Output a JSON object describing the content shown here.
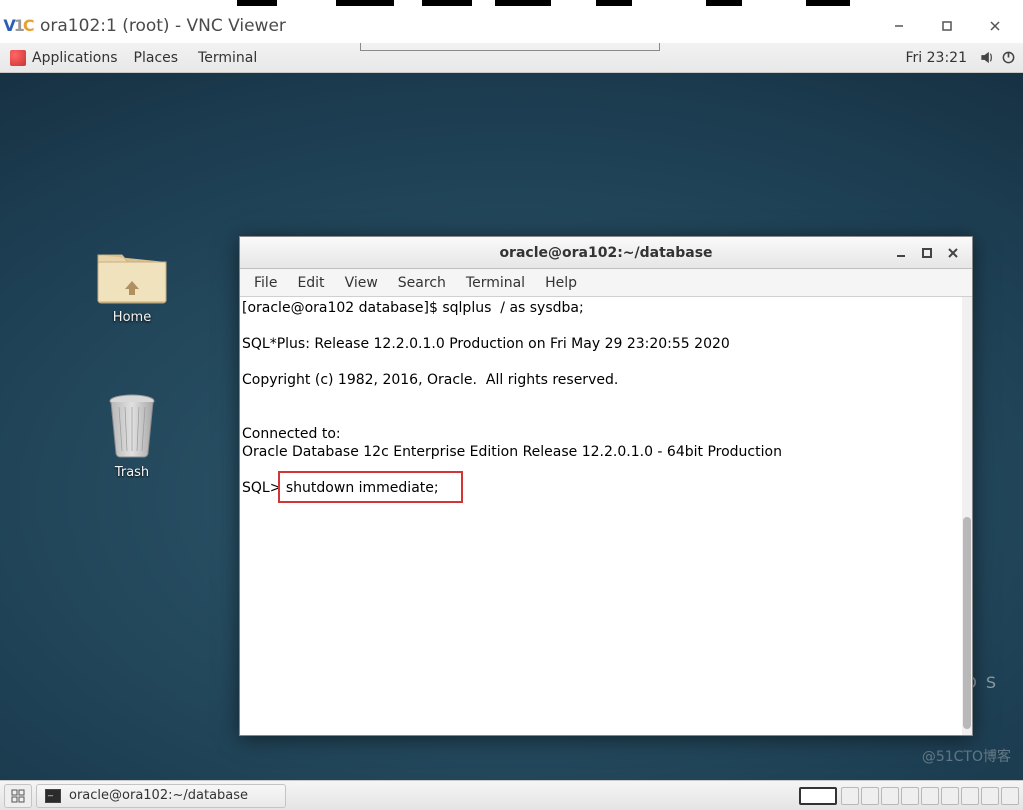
{
  "vnc": {
    "title": "ora102:1 (root) - VNC Viewer",
    "logo_v": "V",
    "logo_n": "1",
    "logo_c": "C"
  },
  "gnome": {
    "applications": "Applications",
    "places": "Places",
    "terminal": "Terminal",
    "clock": "Fri 23:21"
  },
  "desktop": {
    "home_label": "Home",
    "trash_label": "Trash",
    "centos": "CENTOS",
    "watermark": "@51CTO博客"
  },
  "term": {
    "title": "oracle@ora102:~/database",
    "menu": {
      "file": "File",
      "edit": "Edit",
      "view": "View",
      "search": "Search",
      "terminal": "Terminal",
      "help": "Help"
    },
    "lines": {
      "l1": "[oracle@ora102 database]$ sqlplus  / as sysdba;",
      "l2": "",
      "l3": "SQL*Plus: Release 12.2.0.1.0 Production on Fri May 29 23:20:55 2020",
      "l4": "",
      "l5": "Copyright (c) 1982, 2016, Oracle.  All rights reserved.",
      "l6": "",
      "l7": "",
      "l8": "Connected to:",
      "l9": "Oracle Database 12c Enterprise Edition Release 12.2.0.1.0 - 64bit Production",
      "l10": "",
      "l11_prompt": "SQL> ",
      "l11_cmd": "shutdown immediate;"
    }
  },
  "taskbar": {
    "task_label": "oracle@ora102:~/database"
  }
}
